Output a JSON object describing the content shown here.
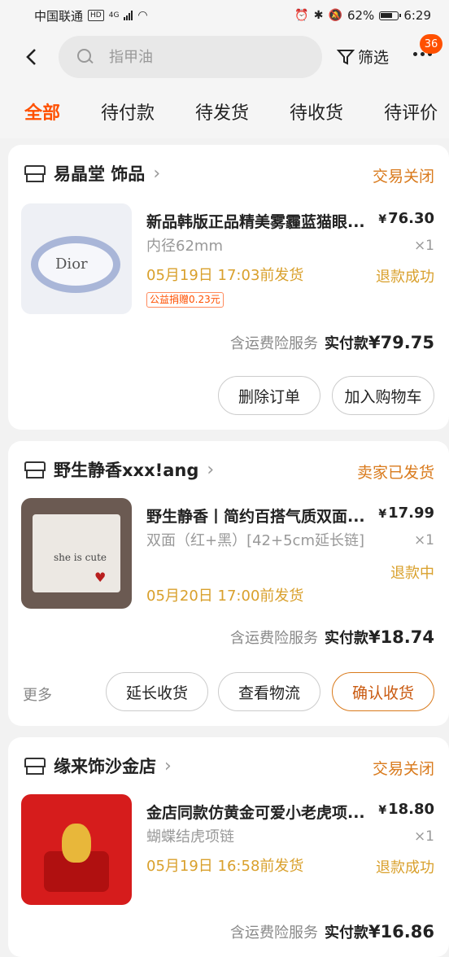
{
  "status_bar": {
    "carrier": "中国联通",
    "hd": "HD",
    "network": "4G",
    "battery": "62%",
    "time": "6:29"
  },
  "header": {
    "search_placeholder": "指甲油",
    "filter_label": "筛选",
    "badge_count": "36"
  },
  "tabs": [
    {
      "label": "全部"
    },
    {
      "label": "待付款"
    },
    {
      "label": "待发货"
    },
    {
      "label": "待收货"
    },
    {
      "label": "待评价"
    }
  ],
  "orders": [
    {
      "store": "易晶堂 饰品",
      "status": "交易关闭",
      "title": "新品韩版正品精美雾霾蓝猫眼...",
      "price": "76.30",
      "spec": "内径62mm",
      "qty": "×1",
      "ship": "05月19日 17:03前发货",
      "refund": "退款成功",
      "charity": "公益捐赠0.23元",
      "total_label": "含运费险服务",
      "paid_label": "实付款",
      "total": "¥79.75",
      "thumb_text": "Dior",
      "buttons": [
        "删除订单",
        "加入购物车"
      ]
    },
    {
      "store": "野生静香xxx!ang",
      "status": "卖家已发货",
      "title": "野生静香丨简约百搭气质双面...",
      "price": "17.99",
      "spec": "双面（红+黑）[42+5cm延长链]",
      "qty": "×1",
      "ship": "05月20日 17:00前发货",
      "refund": "退款中",
      "total_label": "含运费险服务",
      "paid_label": "实付款",
      "total": "¥18.74",
      "thumb_text": "she is cute",
      "more": "更多",
      "buttons": [
        "延长收货",
        "查看物流",
        "确认收货"
      ]
    },
    {
      "store": "缘来饰沙金店",
      "status": "交易关闭",
      "title": "金店同款仿黄金可爱小老虎项...",
      "price": "18.80",
      "spec": "蝴蝶结虎项链",
      "qty": "×1",
      "ship": "05月19日 16:58前发货",
      "refund": "退款成功",
      "total_label": "含运费险服务",
      "paid_label": "实付款",
      "total": "¥16.86"
    }
  ],
  "colors": {
    "accent": "#ff5000",
    "status_orange": "#d97a1c",
    "ship_yellow": "#d9a02c"
  }
}
